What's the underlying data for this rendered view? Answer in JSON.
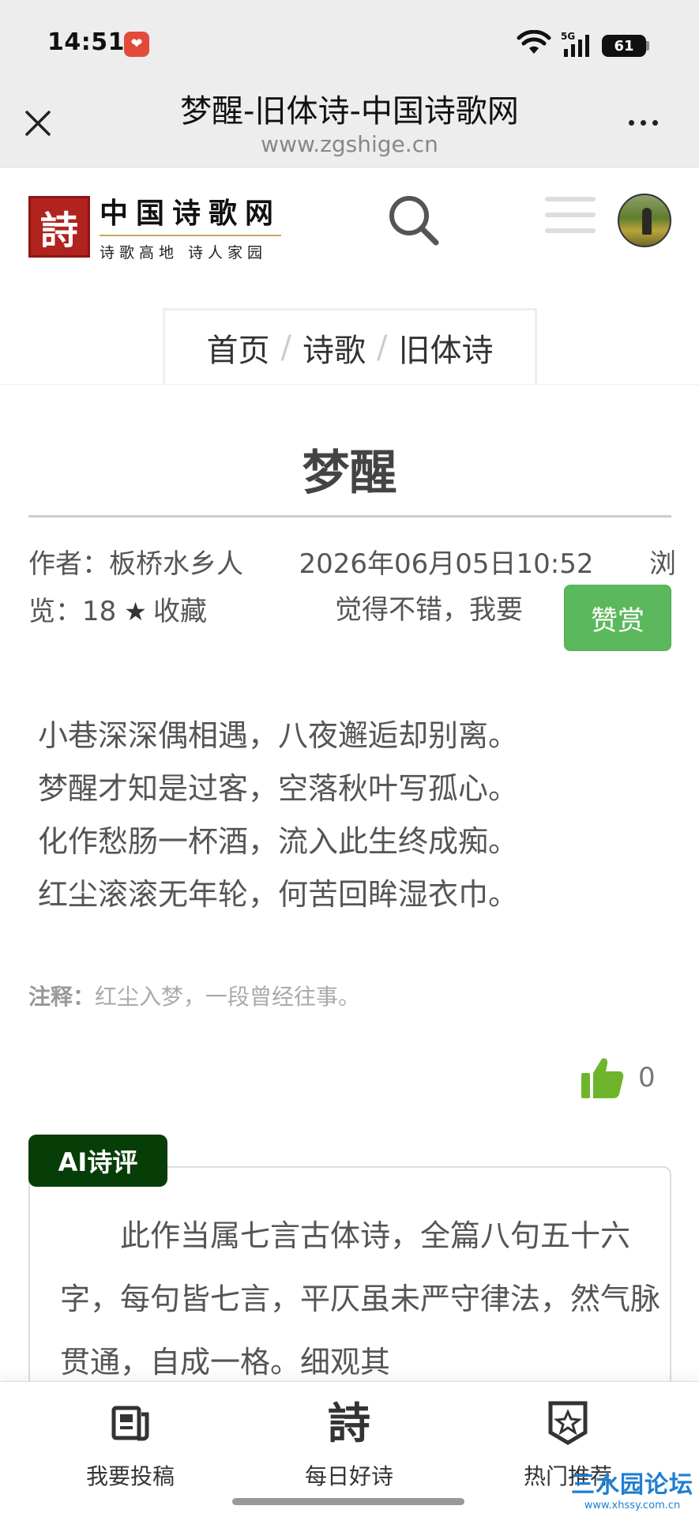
{
  "status_bar": {
    "time": "14:51",
    "app_badge": "❤",
    "network": "5G",
    "battery": "61"
  },
  "title_bar": {
    "title": "梦醒-旧体诗-中国诗歌网",
    "url": "www.zgshige.cn"
  },
  "site_header": {
    "logo_seal": "詩",
    "logo_name": "中国诗歌网",
    "logo_slogan": "诗歌高地 诗人家园"
  },
  "breadcrumb": {
    "items": [
      "首页",
      "诗歌",
      "旧体诗"
    ],
    "separator": "/"
  },
  "article": {
    "title": "梦醒",
    "author_label": "作者：板桥水乡人",
    "datetime": "2026年06月05日10:52",
    "views_label_start": "浏",
    "views_label_end": "览：18",
    "favorite_label": "收藏",
    "praise_hint": "觉得不错，我要",
    "praise_button": "赞赏",
    "poem_lines": [
      "小巷深深偶相遇，八夜邂逅却别离。",
      "梦醒才知是过客，空落秋叶写孤心。",
      "化作愁肠一杯酒，流入此生终成痴。",
      "红尘滚滚无年轮，何苦回眸湿衣巾。"
    ],
    "note_label": "注释：",
    "note_text": "红尘入梦，一段曾经往事。",
    "like_count": "0"
  },
  "ai_review": {
    "tag": "AI诗评",
    "text": "此作当属七言古体诗，全篇八句五十六字，每句皆七言，平仄虽未严守律法，然气脉贯通，自成一格。细观其"
  },
  "bottom_nav": {
    "items": [
      {
        "label": "我要投稿",
        "icon": "submit-doc-icon"
      },
      {
        "label": "每日好诗",
        "icon": "poem-glyph-icon",
        "glyph": "詩"
      },
      {
        "label": "热门推荐",
        "icon": "badge-star-icon"
      }
    ]
  },
  "watermark": {
    "main": "三水园论坛",
    "sub": "www.xhssy.com.cn"
  },
  "colors": {
    "praise_button": "#5cb85c",
    "ai_tag": "#073d07",
    "like_icon": "#6fb52c",
    "logo_red": "#b0231f"
  }
}
